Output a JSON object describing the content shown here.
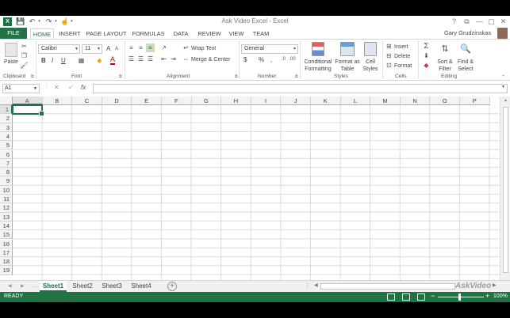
{
  "window": {
    "title": "Ask Video Excel - Excel",
    "controls": [
      "?",
      "⧉",
      "—",
      "▢",
      "✕"
    ]
  },
  "quick_access": {
    "app_icon": "X",
    "save_icon": "save-icon",
    "undo_icon": "undo-icon",
    "redo_icon": "redo-icon",
    "touch_icon": "touch-mode-icon"
  },
  "ribbon_tabs": [
    "FILE",
    "HOME",
    "INSERT",
    "PAGE LAYOUT",
    "FORMULAS",
    "DATA",
    "REVIEW",
    "VIEW",
    "TEAM"
  ],
  "active_tab": "HOME",
  "user": {
    "name": "Gary Grudzinskas"
  },
  "clipboard": {
    "paste_label": "Paste",
    "group_label": "Clipboard"
  },
  "font": {
    "name": "Calibri",
    "size": "11",
    "group_label": "Font",
    "bold": "B",
    "italic": "I",
    "underline": "U",
    "grow": "A",
    "shrink": "A",
    "font_color": "A"
  },
  "alignment": {
    "wrap_text": "Wrap Text",
    "merge_center": "Merge & Center",
    "group_label": "Alignment"
  },
  "number": {
    "format": "General",
    "currency": "$",
    "percent": "%",
    "comma": ",",
    "group_label": "Number"
  },
  "styles": {
    "conditional_formatting": [
      "Conditional",
      "Formatting"
    ],
    "format_as_table": [
      "Format as",
      "Table"
    ],
    "cell_styles": [
      "Cell",
      "Styles"
    ],
    "group_label": "Styles"
  },
  "cells": {
    "insert": "Insert",
    "delete": "Delete",
    "format": "Format",
    "group_label": "Cells"
  },
  "editing": {
    "sort_filter": [
      "Sort &",
      "Filter"
    ],
    "find_select": [
      "Find &",
      "Select"
    ],
    "group_label": "Editing",
    "autosum": "Σ"
  },
  "formula_bar": {
    "name_box": "A1",
    "cancel": "✕",
    "enter": "✓",
    "fx": "fx",
    "value": ""
  },
  "columns": [
    "A",
    "B",
    "C",
    "D",
    "E",
    "F",
    "G",
    "H",
    "I",
    "J",
    "K",
    "L",
    "M",
    "N",
    "O",
    "P"
  ],
  "rows": [
    "1",
    "2",
    "3",
    "4",
    "5",
    "6",
    "7",
    "8",
    "9",
    "10",
    "11",
    "12",
    "13",
    "14",
    "15",
    "16",
    "17",
    "18",
    "19"
  ],
  "sheets": [
    "Sheet1",
    "Sheet2",
    "Sheet3",
    "Sheet4"
  ],
  "active_sheet": "Sheet1",
  "status": {
    "text": "READY",
    "zoom": "100%"
  },
  "watermark": "AskVideo",
  "colors": {
    "excel_green": "#217346",
    "header_bg": "#f3f3f3",
    "gridline": "#dadada"
  }
}
